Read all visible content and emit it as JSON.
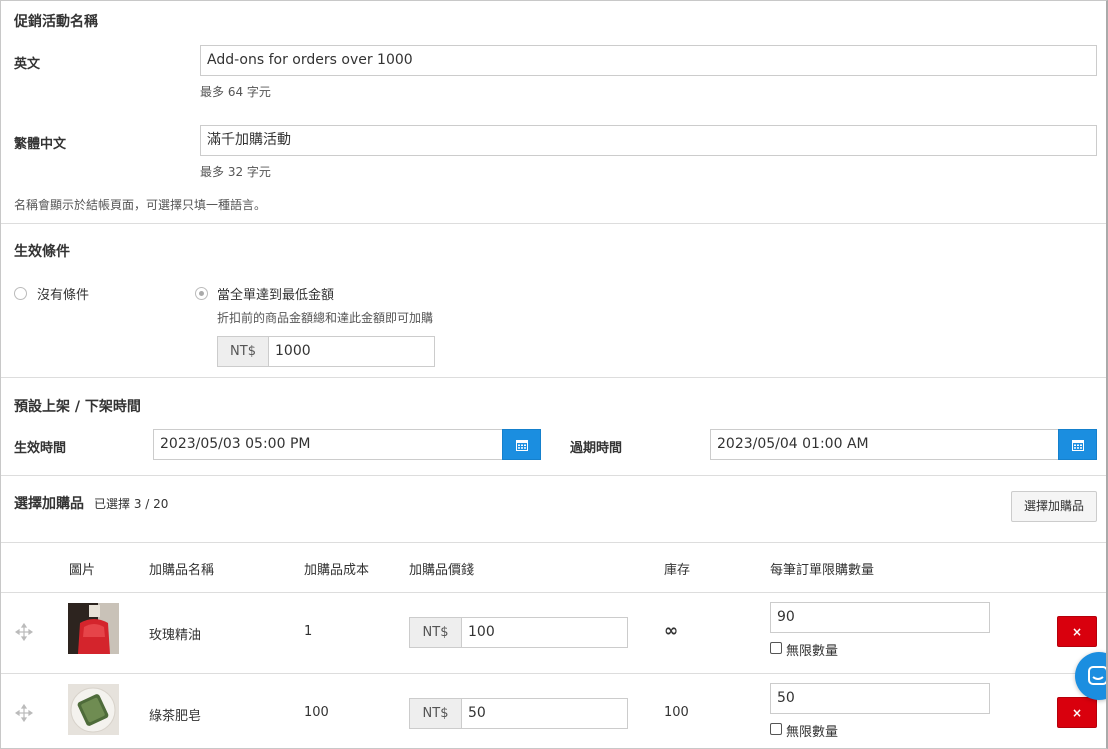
{
  "name_section": {
    "title": "促銷活動名稱",
    "en_label": "英文",
    "en_value": "Add-ons for orders over 1000",
    "en_hint": "最多 64 字元",
    "zh_label": "繁體中文",
    "zh_value": "滿千加購活動",
    "zh_hint": "最多 32 字元",
    "note": "名稱會顯示於結帳頁面，可選擇只填一種語言。"
  },
  "condition_section": {
    "title": "生效條件",
    "option_none": "沒有條件",
    "option_min": "當全單達到最低金額",
    "min_hint": "折扣前的商品金額總和達此金額即可加購",
    "currency": "NT$",
    "min_amount": "1000"
  },
  "schedule_section": {
    "title": "預設上架 / 下架時間",
    "start_label": "生效時間",
    "start_value": "2023/05/03 05:00 PM",
    "end_label": "過期時間",
    "end_value": "2023/05/04 01:00 AM"
  },
  "addon_section": {
    "title": "選擇加購品",
    "count": "已選擇 3 / 20",
    "select_button": "選擇加購品",
    "headers": {
      "image": "圖片",
      "name": "加購品名稱",
      "cost": "加購品成本",
      "price": "加購品價錢",
      "stock": "庫存",
      "limit": "每筆訂單限購數量"
    },
    "rows": [
      {
        "name": "玫瑰精油",
        "cost": "1",
        "currency": "NT$",
        "price": "100",
        "stock": "∞",
        "limit": "90",
        "unlimited_label": "無限數量"
      },
      {
        "name": "綠茶肥皂",
        "cost": "100",
        "currency": "NT$",
        "price": "50",
        "stock": "100",
        "limit": "50",
        "unlimited_label": "無限數量"
      }
    ],
    "delete_symbol": "×"
  },
  "colors": {
    "primary_blue": "#1b8ee0",
    "danger_red": "#d9000d"
  }
}
